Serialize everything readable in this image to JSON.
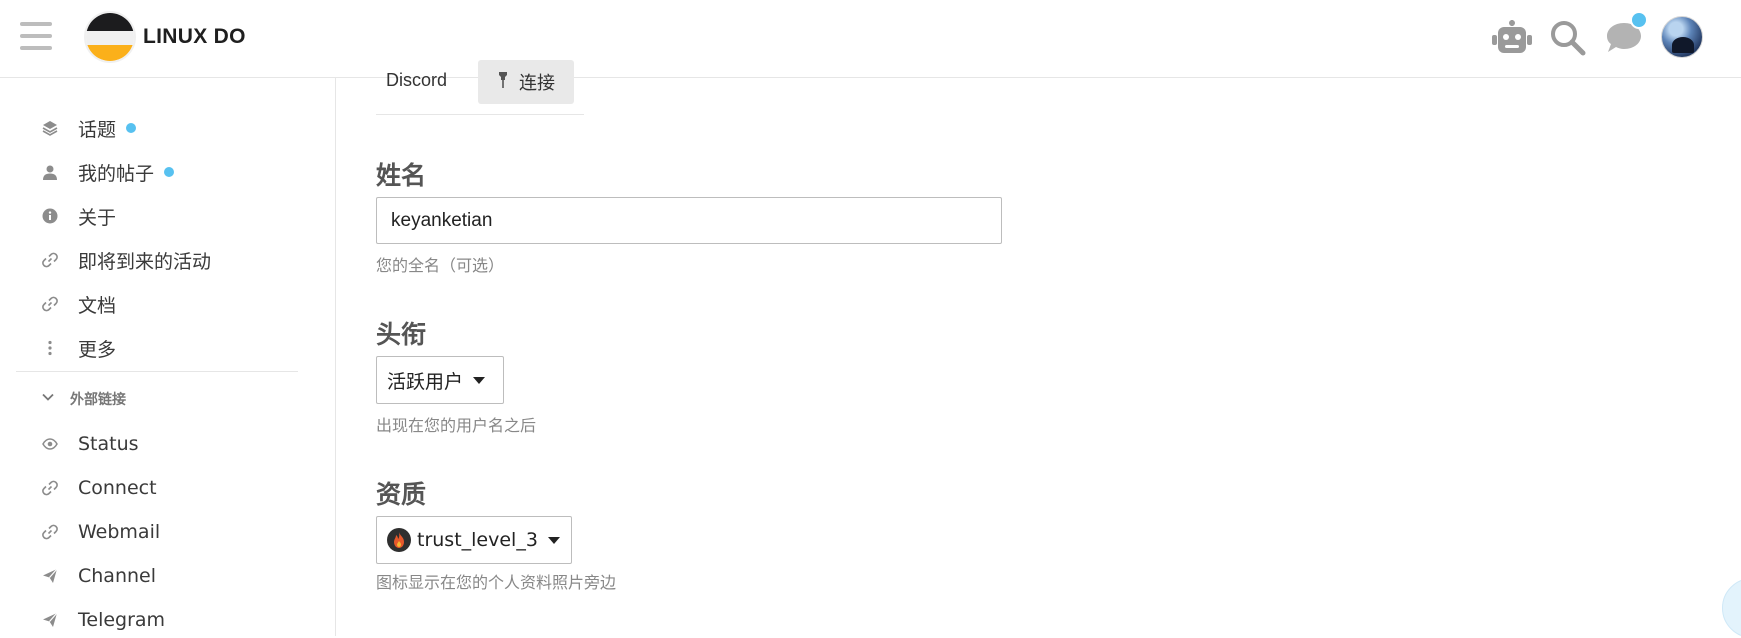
{
  "header": {
    "site_title": "LINUX DO",
    "icons": [
      "menu-icon",
      "robot-icon",
      "search-icon",
      "chat-icon",
      "avatar"
    ],
    "accent_color": "#57c1f0"
  },
  "sidebar": {
    "items": [
      {
        "label": "话题",
        "icon": "layers-icon",
        "unread": true
      },
      {
        "label": "我的帖子",
        "icon": "user-icon",
        "unread": true
      },
      {
        "label": "关于",
        "icon": "info-icon",
        "unread": false
      },
      {
        "label": "即将到来的活动",
        "icon": "link-icon",
        "unread": false
      },
      {
        "label": "文档",
        "icon": "link-icon",
        "unread": false
      },
      {
        "label": "更多",
        "icon": "more-icon",
        "unread": false
      }
    ],
    "section_title": "外部链接",
    "links": [
      {
        "label": "Status",
        "icon": "eye-icon"
      },
      {
        "label": "Connect",
        "icon": "link-icon"
      },
      {
        "label": "Webmail",
        "icon": "link-icon"
      },
      {
        "label": "Channel",
        "icon": "send-icon"
      },
      {
        "label": "Telegram",
        "icon": "send-icon"
      }
    ]
  },
  "main": {
    "discord": {
      "label": "Discord",
      "button": "连接"
    },
    "name": {
      "title": "姓名",
      "value": "keyanketian",
      "hint": "您的全名（可选）"
    },
    "title_field": {
      "title": "头衔",
      "value": "活跃用户",
      "hint": "出现在您的用户名之后"
    },
    "flair": {
      "title": "资质",
      "value": "trust_level_3",
      "hint": "图标显示在您的个人资料照片旁边"
    }
  }
}
